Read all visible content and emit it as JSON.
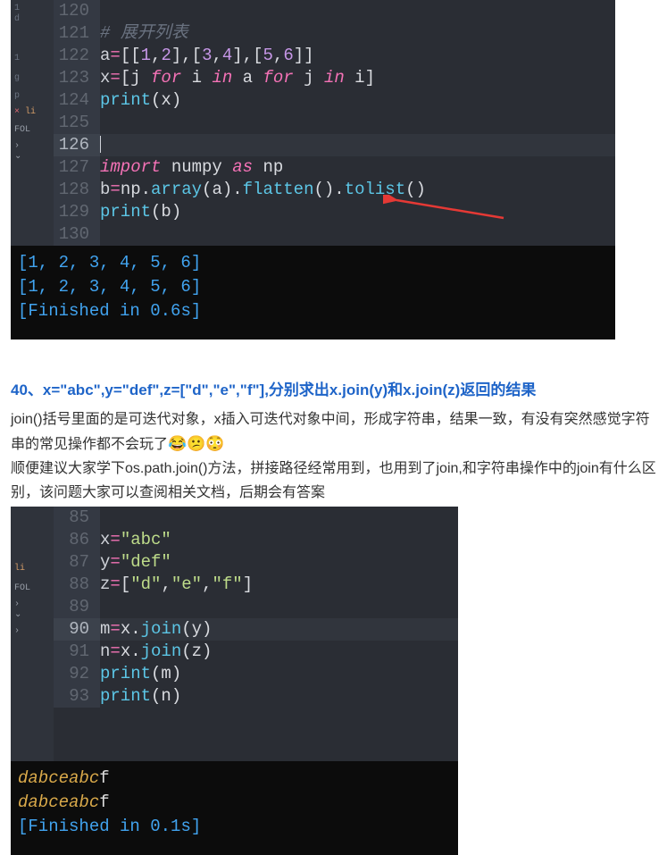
{
  "editor1": {
    "sidebar": {
      "close_x": "×",
      "folders_label": "FOL",
      "chevron_right": "›",
      "chevron_down": "⌄",
      "file_prefix": "li"
    },
    "lines": [
      {
        "n": "120",
        "cls": ""
      },
      {
        "n": "121",
        "cls": ""
      },
      {
        "n": "122",
        "cls": ""
      },
      {
        "n": "123",
        "cls": ""
      },
      {
        "n": "124",
        "cls": ""
      },
      {
        "n": "125",
        "cls": ""
      },
      {
        "n": "126",
        "cls": "active"
      },
      {
        "n": "127",
        "cls": ""
      },
      {
        "n": "128",
        "cls": ""
      },
      {
        "n": "129",
        "cls": ""
      },
      {
        "n": "130",
        "cls": ""
      }
    ],
    "code": {
      "l121_comment": "# 展开列表",
      "l122_a": "a",
      "l122_eq": "=",
      "l122_v": "[[",
      "l122_1": "1",
      "l122_c": ",",
      "l122_2": "2",
      "l122_cb": "],[",
      "l122_3": "3",
      "l122_4": "4",
      "l122_cb2": "],[",
      "l122_5": "5",
      "l122_6": "6",
      "l122_end": "]]",
      "l123_x": "x",
      "l123_eq": "=",
      "l123_ob": "[",
      "l123_j": "j ",
      "l123_for": "for",
      "l123_i": " i ",
      "l123_in": "in",
      "l123_a": " a ",
      "l123_for2": "for",
      "l123_j2": " j ",
      "l123_in2": "in",
      "l123_i2": " i",
      "l123_cb": "]",
      "l124_print": "print",
      "l124_p": "(x)",
      "l127_import": "import",
      "l127_numpy": " numpy ",
      "l127_as": "as",
      "l127_np": " np",
      "l128_b": "b",
      "l128_eq": "=",
      "l128_np": "np",
      "l128_dot": ".",
      "l128_array": "array",
      "l128_pa": "(a).",
      "l128_flatten": "flatten",
      "l128_pb": "().",
      "l128_tolist": "tolist",
      "l128_pc": "()",
      "l129_print": "print",
      "l129_p": "(b)"
    },
    "output_l1": "[1, 2, 3, 4, 5, 6]",
    "output_l2": "[1, 2, 3, 4, 5, 6]",
    "output_l3_a": "[Finished in ",
    "output_l3_b": "0.6s",
    "output_l3_c": "]"
  },
  "question": {
    "title": "40、x=\"abc\",y=\"def\",z=[\"d\",\"e\",\"f\"],分别求出x.join(y)和x.join(z)返回的结果",
    "p1": "join()括号里面的是可迭代对象，x插入可迭代对象中间，形成字符串，结果一致，有没有突然感觉字符串的常见操作都不会玩了",
    "emoji": "😂😕😳",
    "p2": "顺便建议大家学下os.path.join()方法，拼接路径经常用到，也用到了join,和字符串操作中的join有什么区别，该问题大家可以查阅相关文档，后期会有答案"
  },
  "editor2": {
    "sidebar": {
      "folders_label": "FOL",
      "chevron_right": "›",
      "chevron_down": "⌄",
      "file_prefix": "li"
    },
    "lines": [
      {
        "n": "85",
        "cls": ""
      },
      {
        "n": "86",
        "cls": ""
      },
      {
        "n": "87",
        "cls": ""
      },
      {
        "n": "88",
        "cls": ""
      },
      {
        "n": "89",
        "cls": ""
      },
      {
        "n": "90",
        "cls": "active"
      },
      {
        "n": "91",
        "cls": ""
      },
      {
        "n": "92",
        "cls": ""
      },
      {
        "n": "93",
        "cls": ""
      }
    ],
    "code": {
      "l86_x": "x",
      "l86_eq": "=",
      "l86_s": "\"abc\"",
      "l87_y": "y",
      "l87_eq": "=",
      "l87_s": "\"def\"",
      "l88_z": "z",
      "l88_eq": "=",
      "l88_ob": "[",
      "l88_d": "\"d\"",
      "l88_c": ",",
      "l88_e": "\"e\"",
      "l88_f": "\"f\"",
      "l88_cb": "]",
      "l90_m": "m",
      "l90_eq": "=",
      "l90_x": "x",
      "l90_dot": ".",
      "l90_join": "join",
      "l90_p": "(y)",
      "l91_n": "n",
      "l91_eq": "=",
      "l91_x": "x",
      "l91_dot": ".",
      "l91_join": "join",
      "l91_p": "(z)",
      "l92_print": "print",
      "l92_p": "(m)",
      "l93_print": "print",
      "l93_p": "(n)"
    },
    "out_l1_a": "dabceabc",
    "out_l1_b": "f",
    "out_l2_a": "dabceabc",
    "out_l2_b": "f",
    "out_l3_a": "[Finished in ",
    "out_l3_b": "0.1s",
    "out_l3_c": "]"
  }
}
